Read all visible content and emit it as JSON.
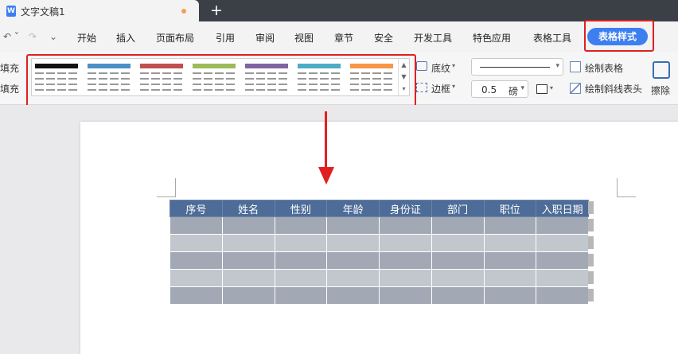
{
  "tab": {
    "title": "文字文稿1",
    "icon": "writer-doc-icon",
    "new_tab": "+"
  },
  "quick_access": {
    "undo": "↶ ˅",
    "redo": "↷",
    "more": "⌄"
  },
  "menu": {
    "items": [
      "开始",
      "插入",
      "页面布局",
      "引用",
      "审阅",
      "视图",
      "章节",
      "安全",
      "开发工具",
      "特色应用",
      "表格工具"
    ],
    "active": "表格样式"
  },
  "ribbon": {
    "fill_label_1": "填充",
    "fill_label_2": "填充",
    "shading_label": "底纹",
    "border_label": "边框",
    "line_weight_value": "0.5",
    "line_weight_unit": "磅",
    "draw_table_label": "绘制表格",
    "draw_diagonal_label": "绘制斜线表头",
    "erase_label": "擦除",
    "style_colors": [
      "#111111",
      "#4a90c8",
      "#c0504d",
      "#9bbb59",
      "#8064a2",
      "#4bacc6",
      "#f79646"
    ]
  },
  "table": {
    "headers": [
      "序号",
      "姓名",
      "性别",
      "年龄",
      "身份证",
      "部门",
      "职位",
      "入职日期"
    ],
    "row_count": 5,
    "header_color": "#4e6c98"
  },
  "accent": {
    "highlight": "#e02020",
    "primary": "#3d7ff0"
  }
}
